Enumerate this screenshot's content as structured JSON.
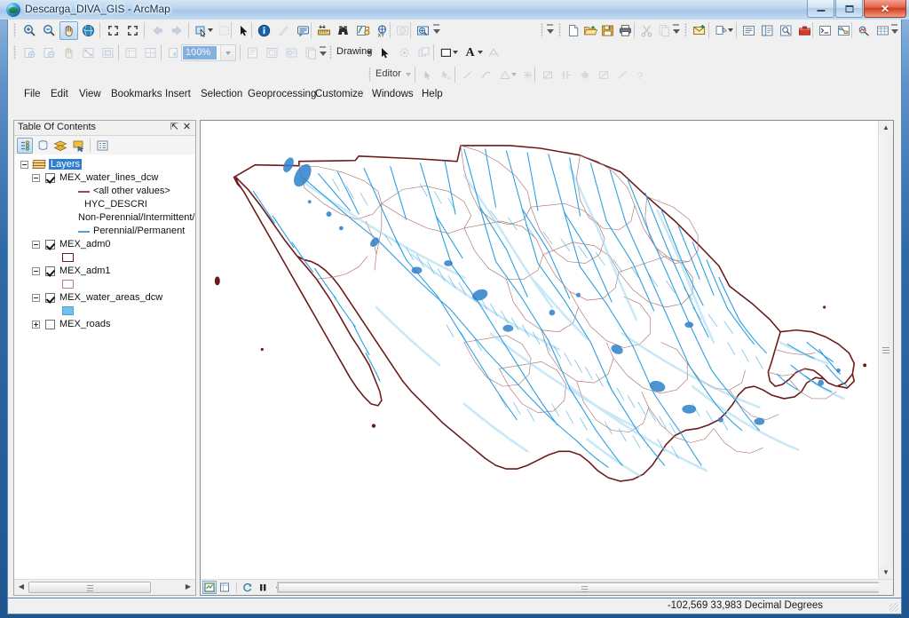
{
  "window": {
    "title": "Descarga_DIVA_GIS - ArcMap",
    "app_icon": "globe-icon",
    "minimize_label": "Minimize",
    "maximize_label": "Maximize",
    "close_label": "Close",
    "close_glyph": "✕"
  },
  "menubar": {
    "items": [
      {
        "label": "File"
      },
      {
        "label": "Edit"
      },
      {
        "label": "View"
      },
      {
        "label": "Bookmarks"
      },
      {
        "label": "Insert"
      },
      {
        "label": "Selection"
      },
      {
        "label": "Geoprocessing"
      },
      {
        "label": "Customize"
      },
      {
        "label": "Windows"
      },
      {
        "label": "Help"
      }
    ]
  },
  "toolbars": {
    "tools": {
      "name": "Tools",
      "buttons": [
        {
          "icon": "zoom-in-icon",
          "enabled": true,
          "selected": false
        },
        {
          "icon": "zoom-out-icon",
          "enabled": true,
          "selected": false
        },
        {
          "icon": "pan-hand-icon",
          "enabled": true,
          "selected": true
        },
        {
          "icon": "full-extent-globe-icon",
          "enabled": true,
          "selected": false
        },
        {
          "icon": "fixed-zoom-in-icon",
          "enabled": true,
          "selected": false
        },
        {
          "icon": "fixed-zoom-out-icon",
          "enabled": true,
          "selected": false
        },
        {
          "icon": "go-back-extent-icon",
          "enabled": false,
          "selected": false
        },
        {
          "icon": "go-forward-extent-icon",
          "enabled": false,
          "selected": false
        },
        {
          "icon": "select-features-icon",
          "enabled": true,
          "selected": false
        },
        {
          "icon": "clear-selection-icon",
          "enabled": false,
          "selected": false
        },
        {
          "icon": "select-elements-arrow-icon",
          "enabled": true,
          "selected": false
        },
        {
          "icon": "identify-icon",
          "enabled": true,
          "selected": false
        },
        {
          "icon": "hyperlink-icon",
          "enabled": false,
          "selected": false
        },
        {
          "icon": "html-popup-icon",
          "enabled": true,
          "selected": false
        },
        {
          "icon": "measure-icon",
          "enabled": true,
          "selected": false
        },
        {
          "icon": "find-binoculars-icon",
          "enabled": true,
          "selected": false
        },
        {
          "icon": "find-route-icon",
          "enabled": true,
          "selected": false
        },
        {
          "icon": "go-to-xy-icon",
          "enabled": true,
          "selected": false
        },
        {
          "icon": "time-slider-icon",
          "enabled": false,
          "selected": false
        },
        {
          "icon": "create-viewer-window-icon",
          "enabled": true,
          "selected": false
        }
      ]
    },
    "standard_right": {
      "name": "Standard",
      "buttons": [
        {
          "icon": "new-document-icon",
          "enabled": true
        },
        {
          "icon": "open-folder-icon",
          "enabled": true
        },
        {
          "icon": "save-icon",
          "enabled": true
        },
        {
          "icon": "print-icon",
          "enabled": true
        },
        {
          "icon": "cut-scissors-icon",
          "enabled": false
        },
        {
          "icon": "copy-icon",
          "enabled": false
        },
        {
          "icon": "paste-icon",
          "enabled": false
        },
        {
          "icon": "delete-icon",
          "enabled": false
        },
        {
          "icon": "undo-icon",
          "enabled": false
        },
        {
          "icon": "redo-icon",
          "enabled": false
        },
        {
          "icon": "add-data-icon",
          "enabled": true
        },
        {
          "icon": "editor-toolbar-icon",
          "enabled": true
        },
        {
          "icon": "table-of-contents-icon",
          "enabled": true
        },
        {
          "icon": "catalog-window-icon",
          "enabled": true
        },
        {
          "icon": "search-window-icon",
          "enabled": true
        },
        {
          "icon": "arctoolbox-icon",
          "enabled": true
        },
        {
          "icon": "python-window-icon",
          "enabled": true
        },
        {
          "icon": "model-builder-icon",
          "enabled": true
        }
      ]
    },
    "layout": {
      "name": "Layout",
      "buttons": [
        {
          "icon": "layout-zoom-in-icon",
          "enabled": false
        },
        {
          "icon": "layout-zoom-out-icon",
          "enabled": false
        },
        {
          "icon": "layout-pan-icon",
          "enabled": false
        },
        {
          "icon": "layout-full-extent-icon",
          "enabled": false
        },
        {
          "icon": "layout-fixed-zoom-icon",
          "enabled": false
        },
        {
          "icon": "layout-zoom-whole-page-icon",
          "enabled": false
        },
        {
          "icon": "layout-zoom-100-icon",
          "enabled": false
        },
        {
          "icon": "layout-go-back-icon",
          "enabled": false
        },
        {
          "icon": "layout-go-forward-icon",
          "enabled": false
        }
      ],
      "zoom_combo_value": "100%",
      "after_combo": [
        {
          "icon": "toggle-draft-mode-icon",
          "enabled": false
        },
        {
          "icon": "focus-data-frame-icon",
          "enabled": false
        },
        {
          "icon": "change-layout-icon",
          "enabled": false
        },
        {
          "icon": "data-driven-pages-icon",
          "enabled": false
        }
      ]
    },
    "drawing": {
      "name": "Drawing",
      "menu_label": "Drawing",
      "buttons": [
        {
          "icon": "select-elements-icon",
          "enabled": true
        },
        {
          "icon": "rotate-element-icon",
          "enabled": false
        },
        {
          "icon": "drawing-order-icon",
          "enabled": false
        },
        {
          "icon": "new-rectangle-icon",
          "enabled": true
        },
        {
          "icon": "fill-color-dropdown-icon",
          "enabled": true
        },
        {
          "icon": "font-color-icon",
          "enabled": true
        },
        {
          "icon": "new-text-icon",
          "enabled": false
        }
      ],
      "font_label": "A"
    },
    "editor": {
      "name": "Editor",
      "menu_label": "Editor",
      "buttons": [
        {
          "icon": "edit-tool-arrow-icon",
          "enabled": false
        },
        {
          "icon": "edit-annotation-icon",
          "enabled": false
        },
        {
          "icon": "straight-segment-icon",
          "enabled": false
        },
        {
          "icon": "curve-segment-icon",
          "enabled": false
        },
        {
          "icon": "construction-tool-icon",
          "enabled": false
        },
        {
          "icon": "snapping-icon",
          "enabled": false
        },
        {
          "icon": "trace-icon",
          "enabled": false
        },
        {
          "icon": "split-tool-icon",
          "enabled": false
        },
        {
          "icon": "rotate-tool-icon",
          "enabled": false
        },
        {
          "icon": "attributes-icon",
          "enabled": false
        },
        {
          "icon": "sketch-properties-icon",
          "enabled": false
        },
        {
          "icon": "create-features-icon",
          "enabled": false
        }
      ]
    }
  },
  "toc": {
    "title": "Table Of Contents",
    "pin_icon": "pin-icon",
    "pin_glyph": "⇱",
    "close_icon": "close-icon",
    "close_glyph": "✕",
    "tools": [
      {
        "icon": "list-by-drawing-order-icon",
        "selected": true
      },
      {
        "icon": "list-by-source-icon",
        "selected": false
      },
      {
        "icon": "list-by-visibility-icon",
        "selected": false
      },
      {
        "icon": "list-by-selection-icon",
        "selected": false
      },
      {
        "icon": "toc-options-icon",
        "selected": false
      }
    ],
    "tree": {
      "root": {
        "label": "Layers",
        "selected": true,
        "expanded": true,
        "icon": "layers-stack-icon"
      },
      "layers": [
        {
          "label": "MEX_water_lines_dcw",
          "checked": true,
          "expanded": true,
          "symbols": [
            {
              "type": "line",
              "label": "<all other values>",
              "color": "#9c4b52"
            },
            {
              "type": "heading",
              "label": "HYC_DESCRI"
            },
            {
              "type": "text",
              "label": "Non-Perennial/Intermittent/F"
            },
            {
              "type": "line",
              "label": "Perennial/Permanent",
              "color": "#4d9fd4"
            }
          ]
        },
        {
          "label": "MEX_adm0",
          "checked": true,
          "expanded": true,
          "symbols": [
            {
              "type": "polygon",
              "label": "",
              "outline": "#6d1a1a",
              "fill": "#ffffff"
            }
          ]
        },
        {
          "label": "MEX_adm1",
          "checked": true,
          "expanded": true,
          "symbols": [
            {
              "type": "polygon",
              "label": "",
              "outline": "#c07f7f",
              "fill": "#ffffff"
            }
          ]
        },
        {
          "label": "MEX_water_areas_dcw",
          "checked": true,
          "expanded": true,
          "symbols": [
            {
              "type": "polygon",
              "label": "",
              "outline": "#5a9ec9",
              "fill": "#6fc2ef"
            }
          ]
        },
        {
          "label": "MEX_roads",
          "checked": false,
          "expanded": false,
          "symbols": []
        }
      ]
    },
    "hscroll": {
      "left_arrow": "◀",
      "right_arrow": "▶"
    }
  },
  "map": {
    "country": "Mexico",
    "boundary_color": "#6d1a1a",
    "state_boundary_color": "#b07b7b",
    "river_color": "#2c9fe0",
    "river_color_light": "#8fd0f0",
    "water_area_color": "#2f7fc9",
    "background": "#ffffff",
    "vscroll": {
      "up_arrow": "▲",
      "down_arrow": "▼"
    },
    "view_buttons": [
      {
        "icon": "data-view-icon",
        "selected": true
      },
      {
        "icon": "layout-view-icon",
        "selected": false
      },
      {
        "icon": "refresh-view-icon",
        "selected": false
      },
      {
        "icon": "pause-drawing-icon",
        "selected": false
      },
      {
        "icon": "hscroll-left-arrow-icon",
        "selected": false
      }
    ]
  },
  "statusbar": {
    "coordinates": "-102,569  33,983 Decimal Degrees"
  }
}
